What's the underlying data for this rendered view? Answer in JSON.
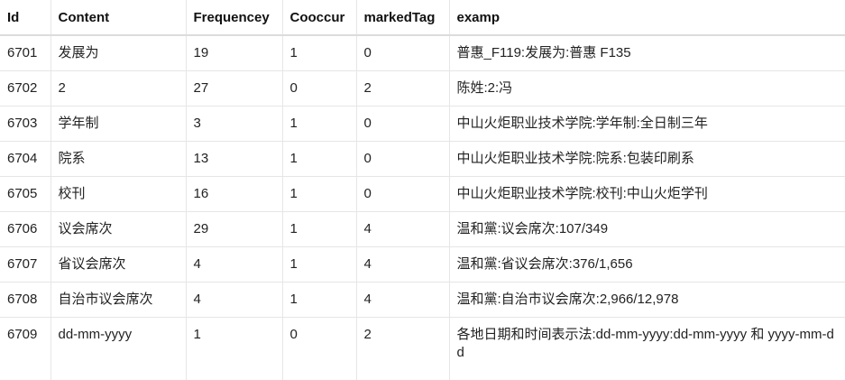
{
  "table": {
    "headers": [
      "Id",
      "Content",
      "Frequencey",
      "Cooccur",
      "markedTag",
      "examp"
    ],
    "rows": [
      [
        "6701",
        "发展为",
        "19",
        "1",
        "0",
        "普惠_F119:发展为:普惠 F135"
      ],
      [
        "6702",
        "2",
        "27",
        "0",
        "2",
        "陈姓:2:冯"
      ],
      [
        "6703",
        "学年制",
        "3",
        "1",
        "0",
        "中山火炬职业技术学院:学年制:全日制三年"
      ],
      [
        "6704",
        "院系",
        "13",
        "1",
        "0",
        "中山火炬职业技术学院:院系:包装印刷系"
      ],
      [
        "6705",
        "校刊",
        "16",
        "1",
        "0",
        "中山火炬职业技术学院:校刊:中山火炬学刊"
      ],
      [
        "6706",
        "议会席次",
        "29",
        "1",
        "4",
        "温和黨:议会席次:107/349"
      ],
      [
        "6707",
        "省议会席次",
        "4",
        "1",
        "4",
        "温和黨:省议会席次:376/1,656"
      ],
      [
        "6708",
        "自治市议会席次",
        "4",
        "1",
        "4",
        "温和黨:自治市议会席次:2,966/12,978"
      ],
      [
        "6709",
        "dd-mm-yyyy",
        "1",
        "0",
        "2",
        "各地日期和时间表示法:dd-mm-yyyy:dd-mm-yyyy 和 yyyy-mm-dd"
      ]
    ]
  }
}
